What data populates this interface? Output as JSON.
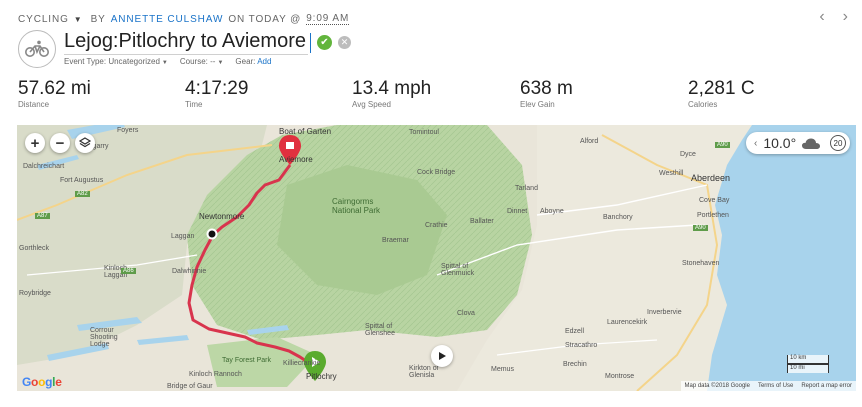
{
  "header": {
    "activity_type": "CYCLING",
    "by": "BY",
    "author": "ANNETTE CULSHAW",
    "on_today": "ON TODAY @",
    "time": "9:09 AM",
    "title": "Lejog:Pitlochry to Aviemore"
  },
  "meta": {
    "event_type": "Event Type: Uncategorized",
    "course": "Course: --",
    "gear_label": "Gear:",
    "gear_add": "Add"
  },
  "stats": [
    {
      "value": "57.62 mi",
      "label": "Distance"
    },
    {
      "value": "4:17:29",
      "label": "Time"
    },
    {
      "value": "13.4 mph",
      "label": "Avg Speed"
    },
    {
      "value": "638 m",
      "label": "Elev Gain"
    },
    {
      "value": "2,281 C",
      "label": "Calories"
    }
  ],
  "map": {
    "weather": {
      "temp": "10.0°",
      "wind": "20",
      "icon": "cloud-icon"
    },
    "places": [
      "Aviemore",
      "Newtonmore",
      "Laggan",
      "Dalwhinnie",
      "Pitlochry",
      "Tay Forest Park",
      "Kinloch Rannoch",
      "Fort Augustus",
      "Dalchreichart",
      "Foyers",
      "Tomintoul",
      "Cock Bridge",
      "Cairngorms National Park",
      "Braemar",
      "Crathie",
      "Ballater",
      "Spittal of Glenmuick",
      "Spittal of Glenshee",
      "Kirkton of Glenisla",
      "Clova",
      "Alford",
      "Aberdeen",
      "Dyce",
      "Westhill",
      "Tarland",
      "Dinnet",
      "Aboyne",
      "Banchory",
      "Portlethen",
      "Cove Bay",
      "Stonehaven",
      "Inverbervie",
      "Laurencekirk",
      "Edzell",
      "Stracathro",
      "Brechin",
      "Montrose",
      "Memus",
      "Kinloch Laggan",
      "Corrour Shooting Lodge",
      "Bridge of Gaur",
      "Killiecrankie",
      "Roybridge",
      "Boat of Garten",
      "Invergarry",
      "Gorthleck"
    ],
    "road_labels": [
      "A82",
      "A86",
      "A90",
      "A90",
      "A87"
    ],
    "scale": {
      "km": "10 km",
      "mi": "10 mi"
    },
    "attribution": [
      "Map data ©2018 Google",
      "Terms of Use",
      "Report a map error"
    ],
    "google_letters": [
      "G",
      "o",
      "o",
      "g",
      "l",
      "e"
    ]
  },
  "colors": {
    "route": "#d8344d",
    "start": "#5aab2e",
    "finish": "#e0303f",
    "accent": "#1a73c8"
  }
}
